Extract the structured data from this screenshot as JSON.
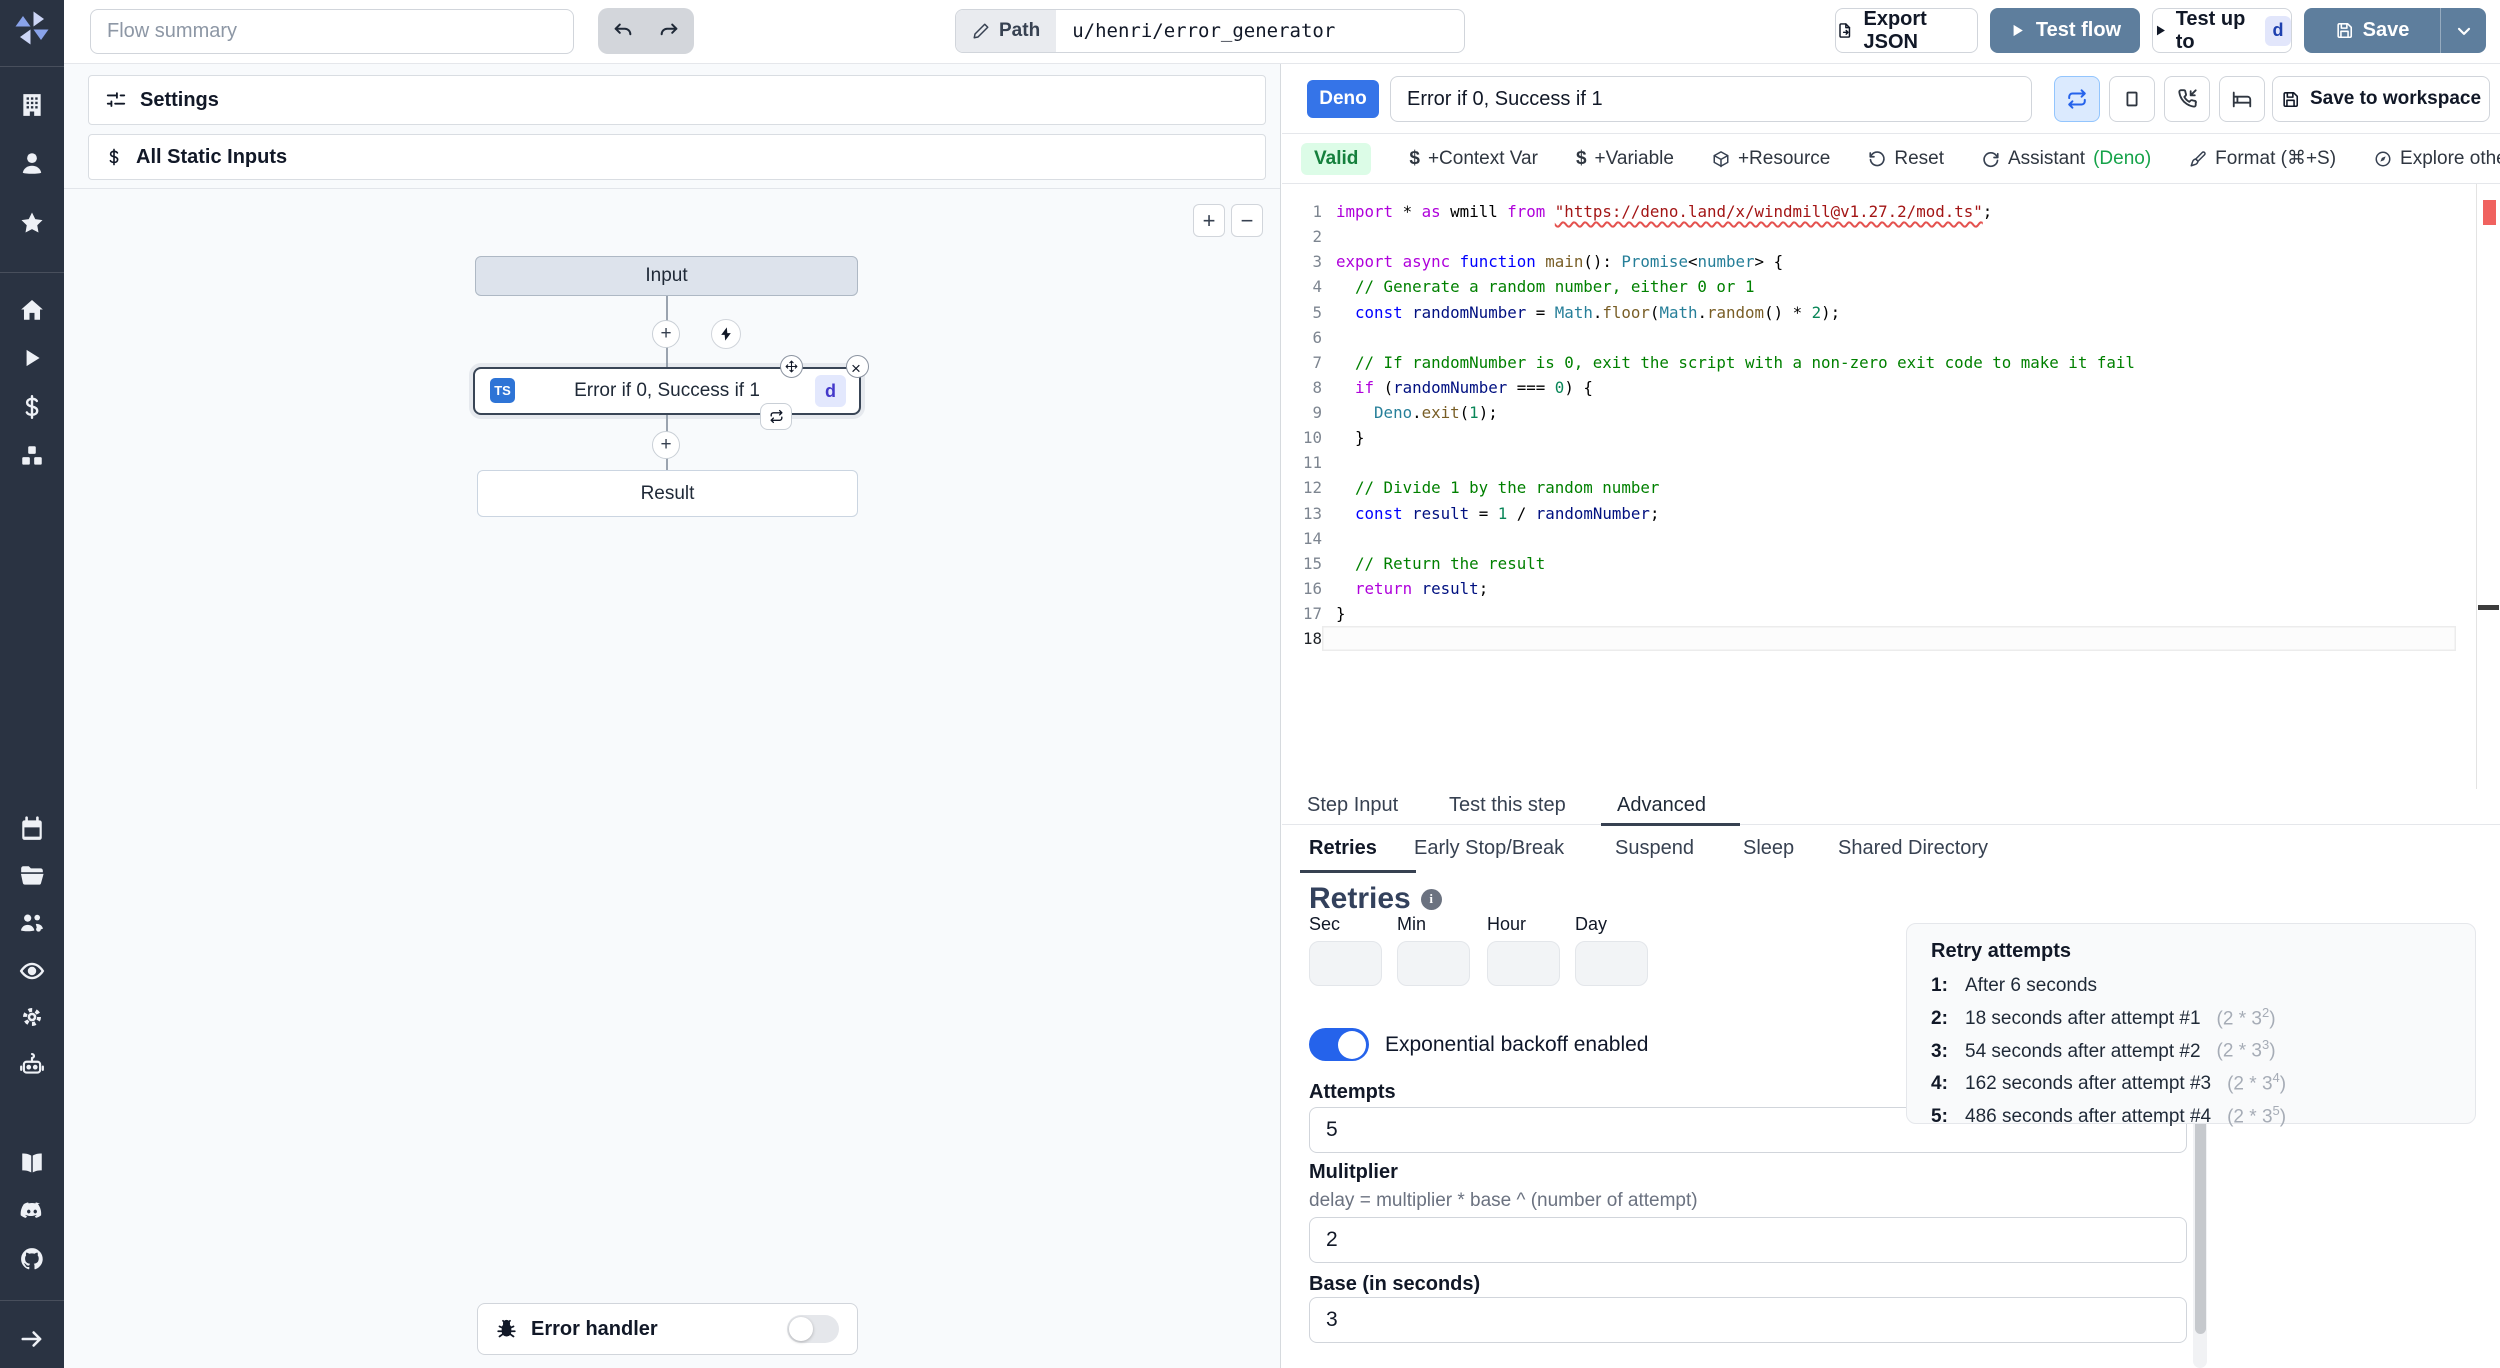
{
  "colors": {
    "accent_blue": "#3574e8",
    "steel_blue": "#5e7e9d",
    "sidebar_bg": "#2a3342",
    "valid_green_bg": "#dcfce7",
    "valid_green_text": "#15803d",
    "toggle_on": "#2563eb",
    "ts_badge": "#2e74d6",
    "error_marker": "#f0625f"
  },
  "sidebar": {
    "icons": [
      "windmill-logo",
      "building",
      "user",
      "star",
      "home",
      "play",
      "dollar",
      "cubes",
      "calendar",
      "folder",
      "user-group",
      "eye",
      "gear",
      "robot",
      "book",
      "discord",
      "github",
      "arrow-right"
    ]
  },
  "topbar": {
    "flow_summary_placeholder": "Flow summary",
    "path_label": "Path",
    "path_value": "u/henri/error_generator",
    "export_json": "Export JSON",
    "test_flow": "Test flow",
    "test_up_to": "Test up to",
    "test_up_to_badge": "d",
    "save": "Save"
  },
  "left_panel": {
    "settings": "Settings",
    "all_static_inputs": "All Static Inputs",
    "zoom_in": "+",
    "zoom_out": "−",
    "flow": {
      "input_node": "Input",
      "step_title": "Error if 0, Success if 1",
      "step_lang_badge": "TS",
      "step_id_badge": "d",
      "result_node": "Result",
      "plus": "+"
    },
    "error_handler": "Error handler"
  },
  "editor": {
    "lang_badge": "Deno",
    "title_value": "Error if 0, Success if 1",
    "save_to_workspace": "Save to workspace",
    "toolbar": {
      "valid": "Valid",
      "context_var": "+Context Var",
      "variable": "+Variable",
      "resource": "+Resource",
      "reset": "Reset",
      "assistant": "Assistant",
      "assistant_lang": "(Deno)",
      "format": "Format (⌘+S)",
      "explore": "Explore other s"
    },
    "code": {
      "lines": [
        {
          "n": "1",
          "toks": [
            [
              "p",
              "import"
            ],
            [
              "d",
              " * "
            ],
            [
              "p",
              "as"
            ],
            [
              "d",
              " wmill "
            ],
            [
              "p",
              "from"
            ],
            [
              "d",
              " "
            ],
            [
              "su",
              "\"https://deno.land/x/windmill@v1.27.2/mod.ts\""
            ],
            [
              "d",
              ";"
            ]
          ]
        },
        {
          "n": "2",
          "toks": []
        },
        {
          "n": "3",
          "toks": [
            [
              "p",
              "export"
            ],
            [
              "d",
              " "
            ],
            [
              "p",
              "async"
            ],
            [
              "d",
              " "
            ],
            [
              "b",
              "function"
            ],
            [
              "d",
              " "
            ],
            [
              "f",
              "main"
            ],
            [
              "d",
              "(): "
            ],
            [
              "t",
              "Promise"
            ],
            [
              "d",
              "<"
            ],
            [
              "t",
              "number"
            ],
            [
              "d",
              "> {"
            ]
          ]
        },
        {
          "n": "4",
          "toks": [
            [
              "c",
              "  // Generate a random number, either 0 or 1"
            ]
          ]
        },
        {
          "n": "5",
          "toks": [
            [
              "d",
              "  "
            ],
            [
              "b",
              "const"
            ],
            [
              "d",
              " "
            ],
            [
              "v",
              "randomNumber"
            ],
            [
              "d",
              " = "
            ],
            [
              "t",
              "Math"
            ],
            [
              "d",
              "."
            ],
            [
              "f",
              "floor"
            ],
            [
              "d",
              "("
            ],
            [
              "t",
              "Math"
            ],
            [
              "d",
              "."
            ],
            [
              "f",
              "random"
            ],
            [
              "d",
              "() * "
            ],
            [
              "n",
              "2"
            ],
            [
              "d",
              ");"
            ]
          ]
        },
        {
          "n": "6",
          "toks": []
        },
        {
          "n": "7",
          "toks": [
            [
              "c",
              "  // If randomNumber is 0, exit the script with a non-zero exit code to make it fail"
            ]
          ]
        },
        {
          "n": "8",
          "toks": [
            [
              "d",
              "  "
            ],
            [
              "p",
              "if"
            ],
            [
              "d",
              " ("
            ],
            [
              "v",
              "randomNumber"
            ],
            [
              "d",
              " === "
            ],
            [
              "n",
              "0"
            ],
            [
              "d",
              ") {"
            ]
          ]
        },
        {
          "n": "9",
          "toks": [
            [
              "d",
              "    "
            ],
            [
              "t",
              "Deno"
            ],
            [
              "d",
              "."
            ],
            [
              "f",
              "exit"
            ],
            [
              "d",
              "("
            ],
            [
              "n",
              "1"
            ],
            [
              "d",
              ");"
            ]
          ]
        },
        {
          "n": "10",
          "toks": [
            [
              "d",
              "  }"
            ]
          ]
        },
        {
          "n": "11",
          "toks": []
        },
        {
          "n": "12",
          "toks": [
            [
              "c",
              "  // Divide 1 by the random number"
            ]
          ]
        },
        {
          "n": "13",
          "toks": [
            [
              "d",
              "  "
            ],
            [
              "b",
              "const"
            ],
            [
              "d",
              " "
            ],
            [
              "v",
              "result"
            ],
            [
              "d",
              " = "
            ],
            [
              "n",
              "1"
            ],
            [
              "d",
              " / "
            ],
            [
              "v",
              "randomNumber"
            ],
            [
              "d",
              ";"
            ]
          ]
        },
        {
          "n": "14",
          "toks": []
        },
        {
          "n": "15",
          "toks": [
            [
              "c",
              "  // Return the result"
            ]
          ]
        },
        {
          "n": "16",
          "toks": [
            [
              "d",
              "  "
            ],
            [
              "p",
              "return"
            ],
            [
              "d",
              " "
            ],
            [
              "v",
              "result"
            ],
            [
              "d",
              ";"
            ]
          ]
        },
        {
          "n": "17",
          "toks": [
            [
              "d",
              "}"
            ]
          ]
        },
        {
          "n": "18",
          "toks": [],
          "cur": true
        }
      ]
    }
  },
  "tabs": {
    "step_tabs": [
      "Step Input",
      "Test this step",
      "Advanced"
    ],
    "advanced_tabs": [
      "Retries",
      "Early Stop/Break",
      "Suspend",
      "Sleep",
      "Shared Directory"
    ]
  },
  "retries": {
    "heading": "Retries",
    "time_labels": [
      "Sec",
      "Min",
      "Hour",
      "Day"
    ],
    "backoff_label": "Exponential backoff enabled",
    "attempts_label": "Attempts",
    "attempts_value": "5",
    "multiplier_label": "Mulitplier",
    "multiplier_desc": "delay = multiplier * base ^ (number of attempt)",
    "multiplier_value": "2",
    "base_label": "Base (in seconds)",
    "base_value": "3"
  },
  "retry_panel": {
    "title": "Retry attempts",
    "items": [
      {
        "n": "1:",
        "t": "After 6 seconds",
        "f": "",
        "s": "",
        "f2": ""
      },
      {
        "n": "2:",
        "t": "18 seconds after attempt #1",
        "f": "(2 * 3",
        "s": "2",
        "f2": ")"
      },
      {
        "n": "3:",
        "t": "54 seconds after attempt #2",
        "f": "(2 * 3",
        "s": "3",
        "f2": ")"
      },
      {
        "n": "4:",
        "t": "162 seconds after attempt #3",
        "f": "(2 * 3",
        "s": "4",
        "f2": ")"
      },
      {
        "n": "5:",
        "t": "486 seconds after attempt #4",
        "f": "(2 * 3",
        "s": "5",
        "f2": ")"
      }
    ]
  }
}
